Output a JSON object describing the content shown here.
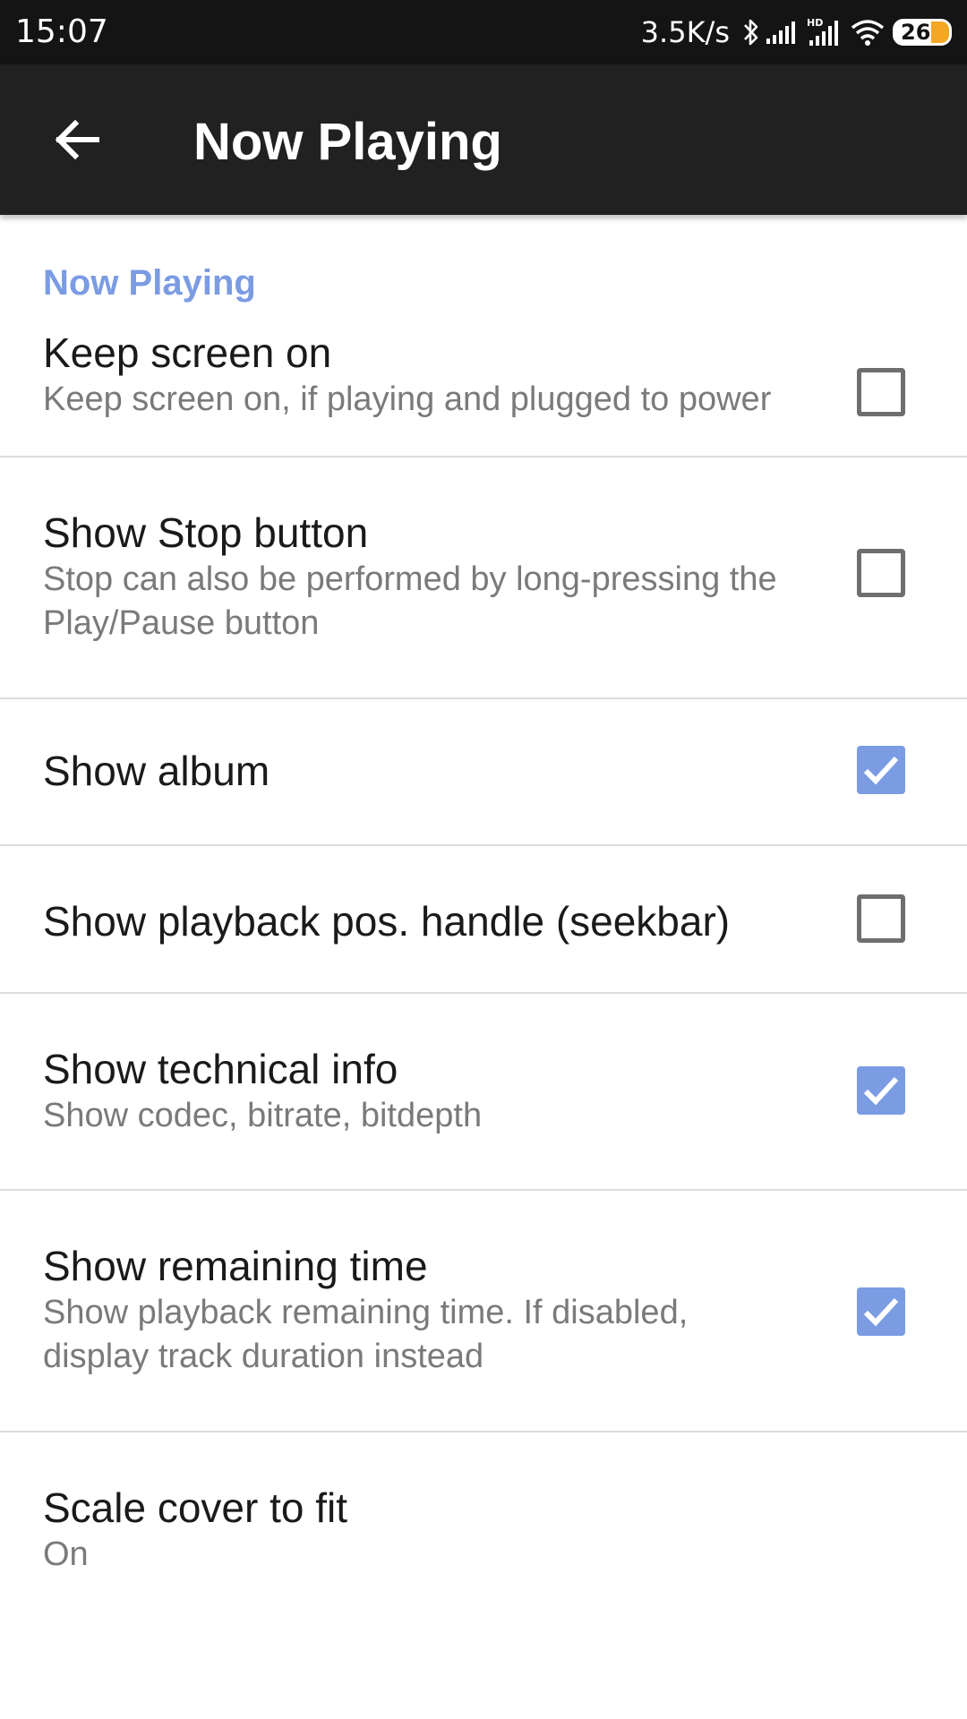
{
  "status_bar": {
    "time": "15:07",
    "net_speed": "3.5K/s",
    "icons": [
      "bluetooth-icon",
      "signal-icon",
      "hd-signal-icon",
      "wifi-icon"
    ],
    "battery_level": "26",
    "battery_color": "#f5a623"
  },
  "app_bar": {
    "back_icon": "arrow-left-icon",
    "title": "Now Playing"
  },
  "section": {
    "header": "Now Playing",
    "accent_color": "#7b9ce3"
  },
  "prefs": [
    {
      "title": "Keep screen on",
      "summary": "Keep screen on, if playing and plugged to power",
      "checked": false
    },
    {
      "title": "Show Stop button",
      "summary": "Stop can also be performed by long-pressing the Play/Pause button",
      "checked": false
    },
    {
      "title": "Show album",
      "summary": "",
      "checked": true
    },
    {
      "title": "Show playback pos. handle (seekbar)",
      "summary": "",
      "checked": false
    },
    {
      "title": "Show technical info",
      "summary": "Show codec, bitrate, bitdepth",
      "checked": true
    },
    {
      "title": "Show remaining time",
      "summary": "Show playback remaining time. If disabled, display track duration instead",
      "checked": true
    },
    {
      "title": "Scale cover to fit",
      "summary": "On"
    }
  ]
}
